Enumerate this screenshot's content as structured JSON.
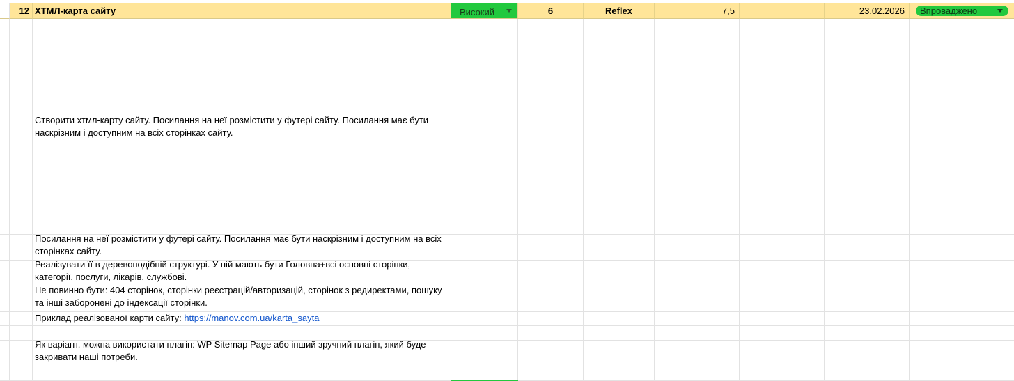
{
  "task": {
    "number": "12",
    "title": "ХТМЛ-карта сайту",
    "priority": "Високий",
    "hours": "6",
    "assignee": "Reflex",
    "score": "7,5",
    "empty_col": "",
    "date": "23.02.2026",
    "status": "Впроваджено"
  },
  "notes": {
    "description": "Створити хтмл-карту сайту. Посилання на неї розмістити у футері сайту. Посилання має бути наскрізним і доступним на всіх сторінках сайту.",
    "line1": "Посилання на неї розмістити у футері сайту. Посилання має бути наскрізним і доступним на всіх сторінках сайту.",
    "line2": "Реалізувати її в деревоподібній структурі. У ній мають бути Головна+всі основні сторінки, категорії, послуги, лікарів, службові.",
    "line3": "Не повинно бути: 404 сторінок, сторінки реєстрацій/авторизацій, сторінок з редиректами, пошуку та інші заборонені до індексації сторінки.",
    "example_label": "Приклад реалізованої карти сайту: ",
    "example_link": "https://manov.com.ua/karta_sayta",
    "line5": "Як варіант, можна використати плагін: WP Sitemap Page або інший зручний плагін, який буде закривати наші потреби."
  },
  "colors": {
    "header_bg": "#ffe599",
    "status_green": "#22c93e",
    "link": "#1155cc",
    "gridline": "#e2e2e2"
  }
}
